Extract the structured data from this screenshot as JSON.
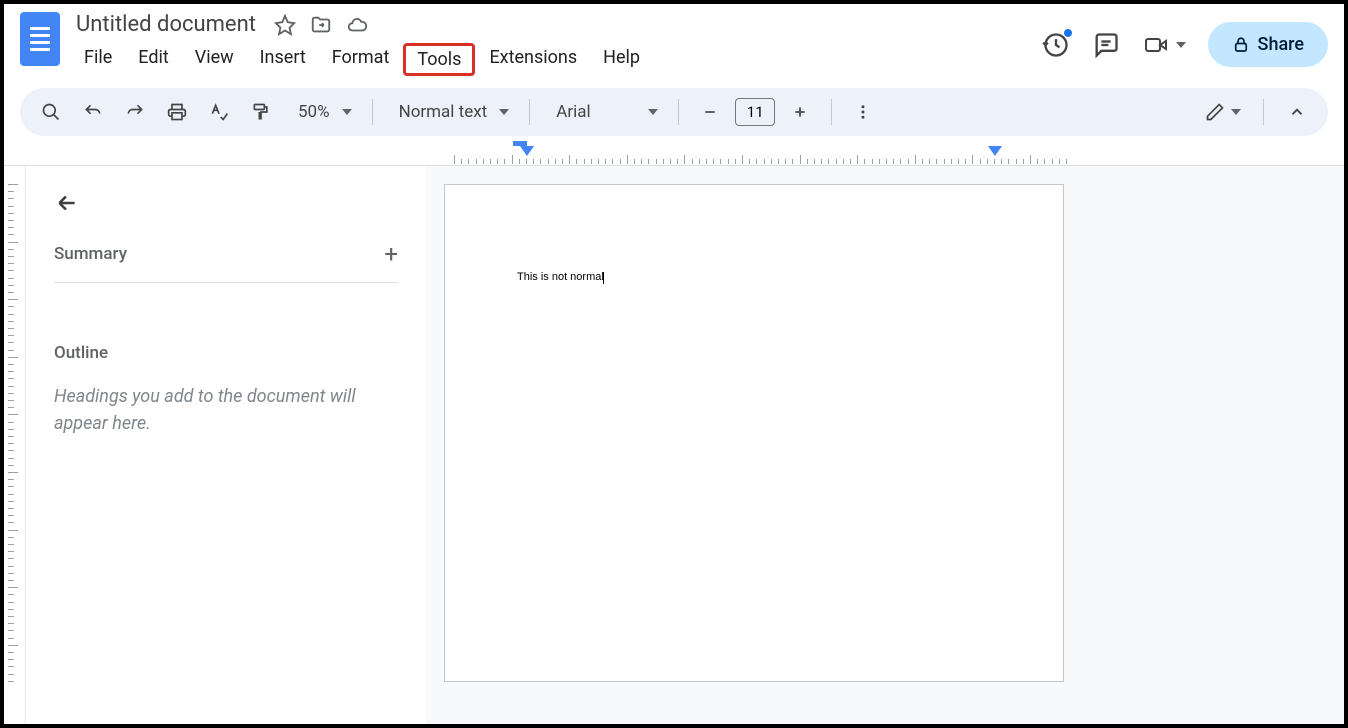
{
  "header": {
    "title": "Untitled document",
    "menus": {
      "file": "File",
      "edit": "Edit",
      "view": "View",
      "insert": "Insert",
      "format": "Format",
      "tools": "Tools",
      "extensions": "Extensions",
      "help": "Help"
    },
    "highlighted_menu": "tools",
    "share_label": "Share"
  },
  "toolbar": {
    "zoom": "50%",
    "style": "Normal text",
    "font": "Arial",
    "font_size": "11"
  },
  "outline": {
    "summary_label": "Summary",
    "heading_label": "Outline",
    "placeholder": "Headings you add to the document will appear here."
  },
  "document": {
    "content": "This is not normal"
  }
}
